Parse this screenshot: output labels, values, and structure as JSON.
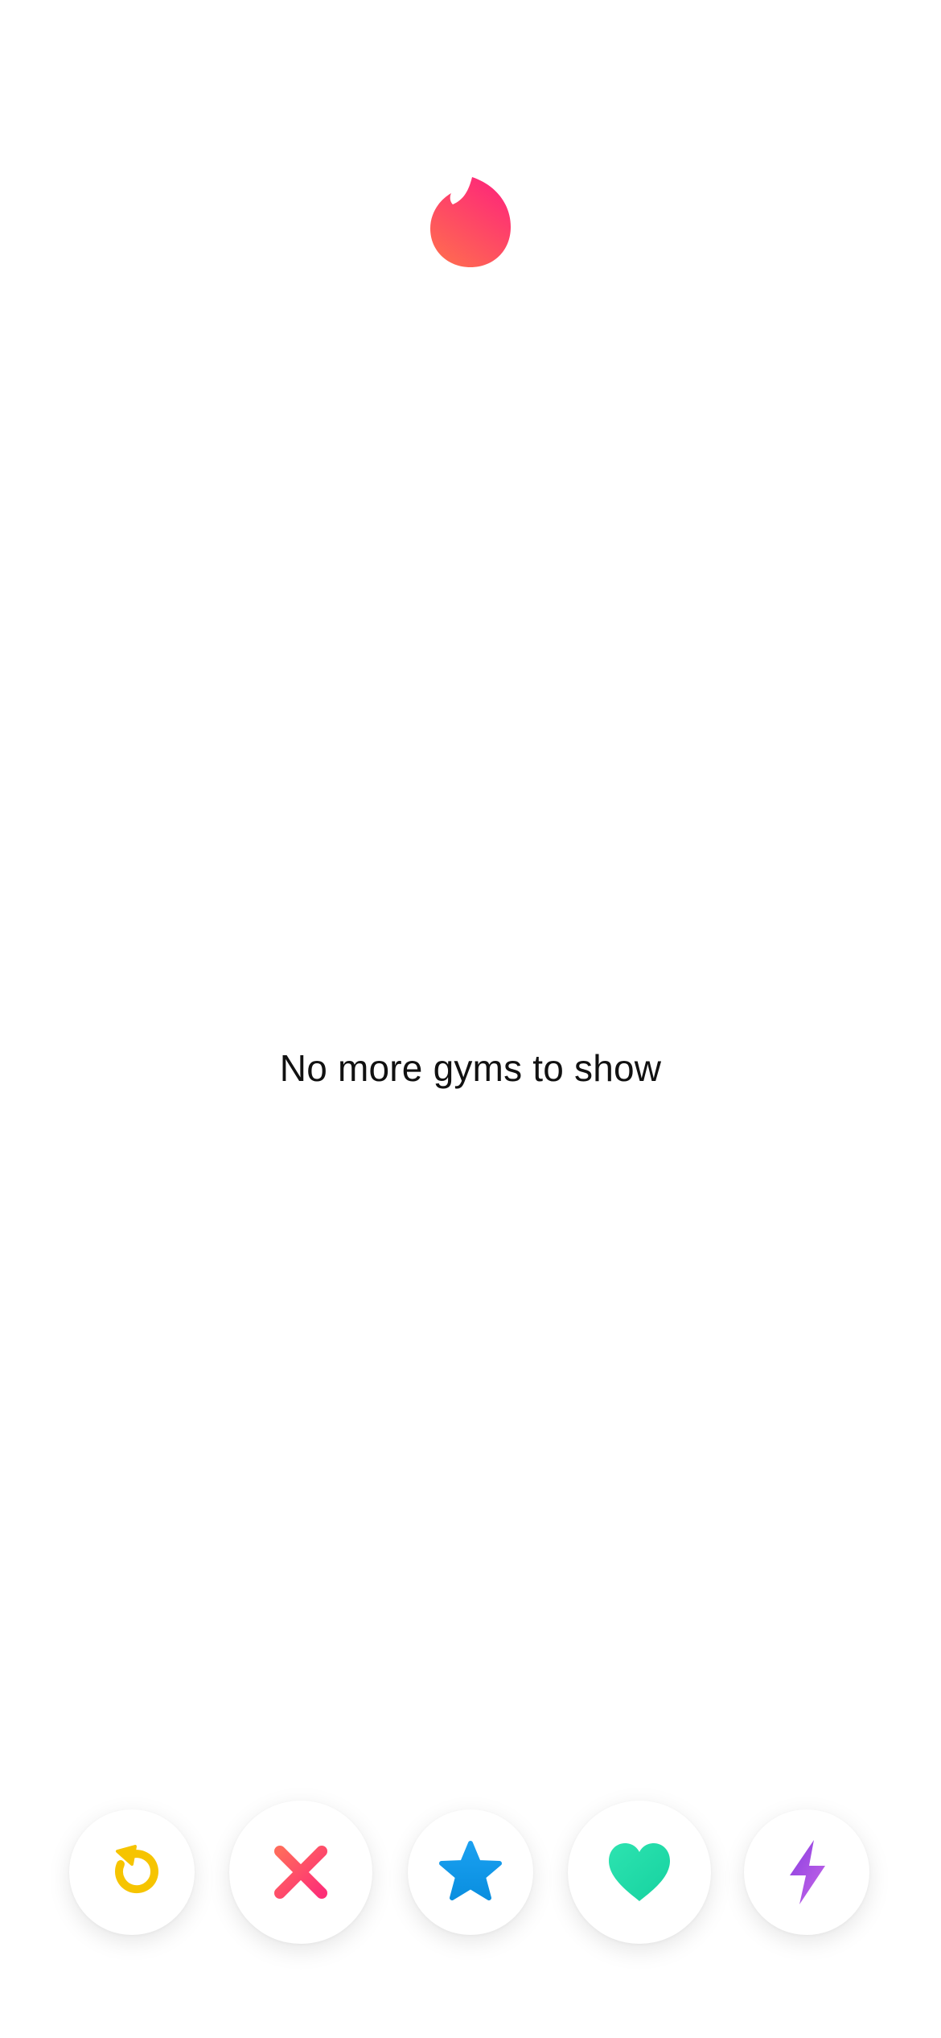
{
  "header": {
    "logo_icon": "flame-icon",
    "logo_colors": [
      "#FD267A",
      "#FF6036"
    ]
  },
  "main": {
    "empty_message": "No more gyms to show"
  },
  "actions": [
    {
      "name": "rewind",
      "icon": "rewind-icon",
      "color": "#F6C400"
    },
    {
      "name": "nope",
      "icon": "close-icon",
      "color": "#FD3C6E"
    },
    {
      "name": "super-like",
      "icon": "star-icon",
      "color": "#1DA1F2"
    },
    {
      "name": "like",
      "icon": "heart-icon",
      "color": "#1FD8A6"
    },
    {
      "name": "boost",
      "icon": "lightning-icon",
      "color": "#A34BE0"
    }
  ]
}
